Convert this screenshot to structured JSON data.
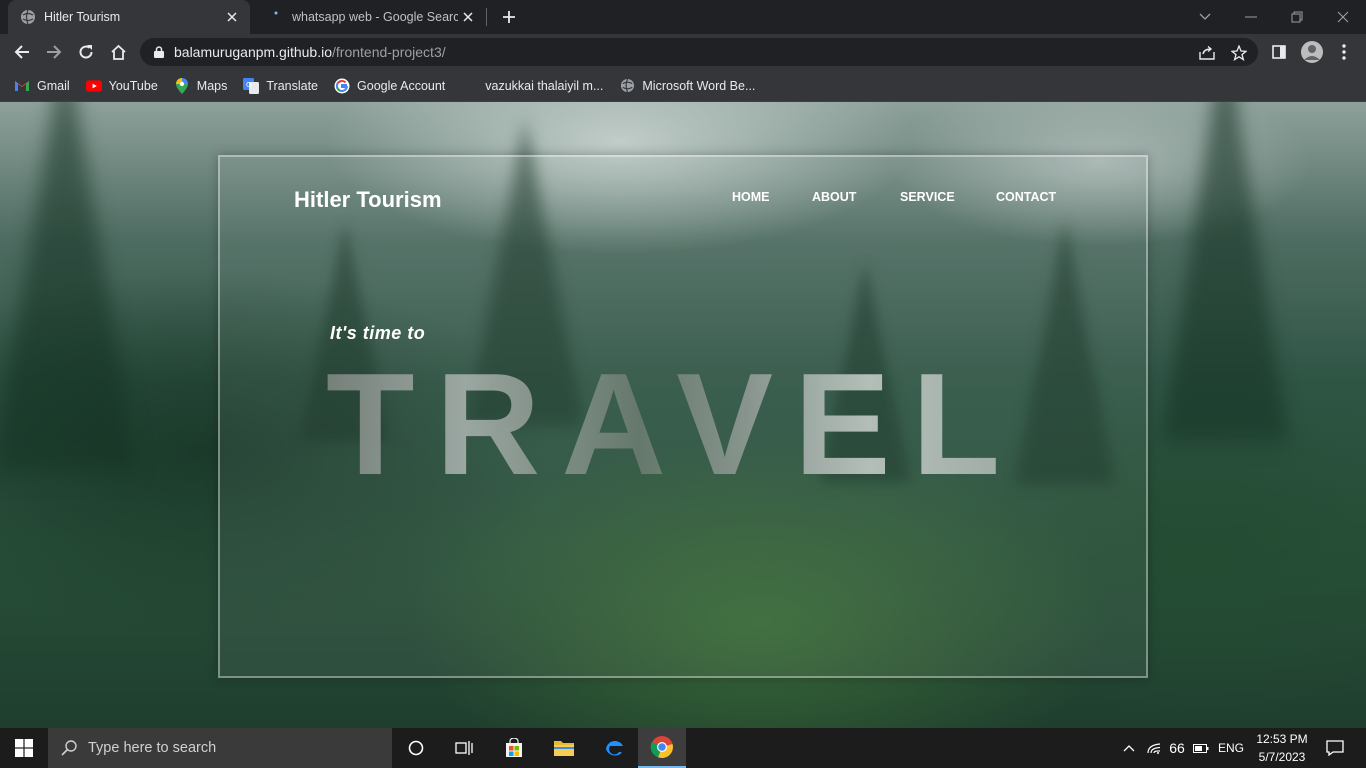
{
  "browser": {
    "tabs": [
      {
        "title": "Hitler Tourism",
        "active": true
      },
      {
        "title": "whatsapp web - Google Search",
        "active": false
      }
    ],
    "url_host": "balamuruganpm.github.io",
    "url_path": "/frontend-project3/",
    "bookmarks": [
      {
        "label": "Gmail",
        "icon": "gmail-icon"
      },
      {
        "label": "YouTube",
        "icon": "youtube-icon"
      },
      {
        "label": "Maps",
        "icon": "maps-icon"
      },
      {
        "label": "Translate",
        "icon": "translate-icon"
      },
      {
        "label": "Google Account",
        "icon": "google-icon"
      },
      {
        "label": "vazukkai thalaiyil m...",
        "icon": ""
      },
      {
        "label": "Microsoft Word Be...",
        "icon": "globe-icon"
      }
    ]
  },
  "site": {
    "logo": "Hitler Tourism",
    "nav": [
      "HOME",
      "ABOUT",
      "SERVICE",
      "CONTACT"
    ],
    "tagline": "It's time to",
    "headline": "TRAVEL"
  },
  "taskbar": {
    "search_placeholder": "Type here to search",
    "battery": "66",
    "language": "ENG",
    "time": "12:53 PM",
    "date": "5/7/2023"
  },
  "colors": {
    "chrome_dark": "#202124",
    "chrome_toolbar": "#35363a",
    "taskbar": "#1c1c1c",
    "accent": "#76b9ed"
  }
}
